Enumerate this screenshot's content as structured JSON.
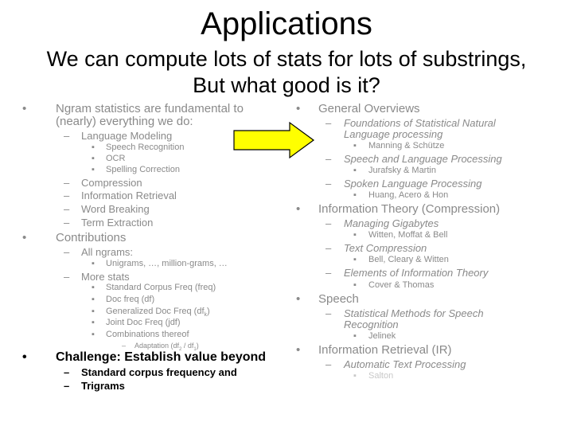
{
  "slide": {
    "title": "Applications",
    "subtitle_line1": "We can compute lots of stats for lots of substrings,",
    "subtitle_line2": "But what good is it?",
    "arrow_color": "#ffff00",
    "markers": {
      "bullet": "•",
      "dash": "–",
      "square": "▪"
    },
    "left": {
      "ngram_line1": "Ngram statistics are fundamental to",
      "ngram_line2": "(nearly) everything we do:",
      "language_modeling": "Language Modeling",
      "lm_items": [
        "Speech Recognition",
        "OCR",
        "Spelling Correction"
      ],
      "other_uses": [
        "Compression",
        "Information Retrieval",
        "Word Breaking",
        "Term Extraction"
      ],
      "contributions": "Contributions",
      "all_ngrams": "All ngrams:",
      "all_ngrams_item": "Unigrams, …, million-grams, …",
      "more_stats": "More stats",
      "stats_items": [
        "Standard Corpus Freq (freq)",
        "Doc freq (df)",
        "Generalized Doc Freq (df",
        "Joint Doc Freq (jdf)",
        "Combinations thereof"
      ],
      "gen_df_sub": "k",
      "gen_df_close": ")",
      "adaptation": "Adaptation (df",
      "adaptation_sub2": "2",
      "adaptation_mid": " / df",
      "adaptation_sub1": "1",
      "adaptation_close": ")",
      "challenge": "Challenge: Establish value beyond",
      "challenge_items": [
        "Standard corpus frequency and",
        "Trigrams"
      ]
    },
    "right": {
      "general_overviews": "General Overviews",
      "books1": [
        {
          "title_line1": "Foundations of Statistical Natural",
          "title_line2": "Language processing",
          "author": "Manning & Schütze"
        },
        {
          "title_line1": "Speech and Language Processing",
          "author": "Jurafsky & Martin"
        },
        {
          "title_line1": "Spoken Language Processing",
          "author": "Huang, Acero & Hon"
        }
      ],
      "info_theory": "Information Theory (Compression)",
      "books2": [
        {
          "title_line1": "Managing Gigabytes",
          "author": "Witten, Moffat & Bell"
        },
        {
          "title_line1": "Text Compression",
          "author": "Bell, Cleary & Witten"
        },
        {
          "title_line1": "Elements of Information Theory",
          "author": "Cover & Thomas"
        }
      ],
      "speech": "Speech",
      "speech_book": {
        "title_line1": "Statistical Methods for Speech",
        "title_line2": "Recognition",
        "author": "Jelinek"
      },
      "ir": "Information Retrieval (IR)",
      "ir_book": {
        "title_line1": "Automatic Text Processing",
        "author": "Salton"
      }
    }
  }
}
